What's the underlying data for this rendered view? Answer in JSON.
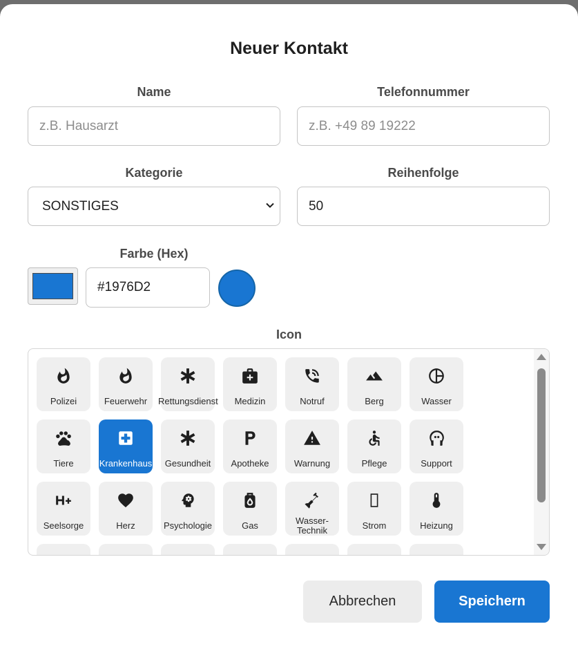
{
  "dialog": {
    "title": "Neuer Kontakt",
    "name_label": "Name",
    "name_placeholder": "z.B. Hausarzt",
    "phone_label": "Telefonnummer",
    "phone_placeholder": "z.B. +49 89 19222",
    "category_label": "Kategorie",
    "category_value": "SONSTIGES",
    "order_label": "Reihenfolge",
    "order_value": "50",
    "color_label": "Farbe (Hex)",
    "color_value": "#1976D2",
    "icon_label": "Icon",
    "cancel_label": "Abbrechen",
    "save_label": "Speichern"
  },
  "colors": {
    "accent": "#1976D2",
    "tile_bg": "#efefef"
  },
  "icons": [
    {
      "label": "Polizei",
      "icon": "fire-icon"
    },
    {
      "label": "Feuerwehr",
      "icon": "fire-icon"
    },
    {
      "label": "Rettungsdienst",
      "icon": "asterisk-icon"
    },
    {
      "label": "Medizin",
      "icon": "medical-bag-icon"
    },
    {
      "label": "Notruf",
      "icon": "phone-call-icon"
    },
    {
      "label": "Berg",
      "icon": "mountain-icon"
    },
    {
      "label": "Wasser",
      "icon": "pie-icon"
    },
    {
      "label": "Tiere",
      "icon": "paw-icon"
    },
    {
      "label": "Krankenhaus",
      "icon": "hospital-icon",
      "selected": true
    },
    {
      "label": "Gesundheit",
      "icon": "asterisk-icon"
    },
    {
      "label": "Apotheke",
      "icon": "pharmacy-p-icon"
    },
    {
      "label": "Warnung",
      "icon": "warning-icon"
    },
    {
      "label": "Pflege",
      "icon": "wheelchair-icon"
    },
    {
      "label": "Support",
      "icon": "headset-icon"
    },
    {
      "label": "Seelsorge",
      "icon": "h-plus-icon"
    },
    {
      "label": "Herz",
      "icon": "heart-icon"
    },
    {
      "label": "Psychologie",
      "icon": "psychology-icon"
    },
    {
      "label": "Gas",
      "icon": "gas-cylinder-icon"
    },
    {
      "label": "Wasser-Technik",
      "icon": "plumbing-icon"
    },
    {
      "label": "Strom",
      "icon": "missing-glyph-icon"
    },
    {
      "label": "Heizung",
      "icon": "thermometer-icon"
    }
  ]
}
